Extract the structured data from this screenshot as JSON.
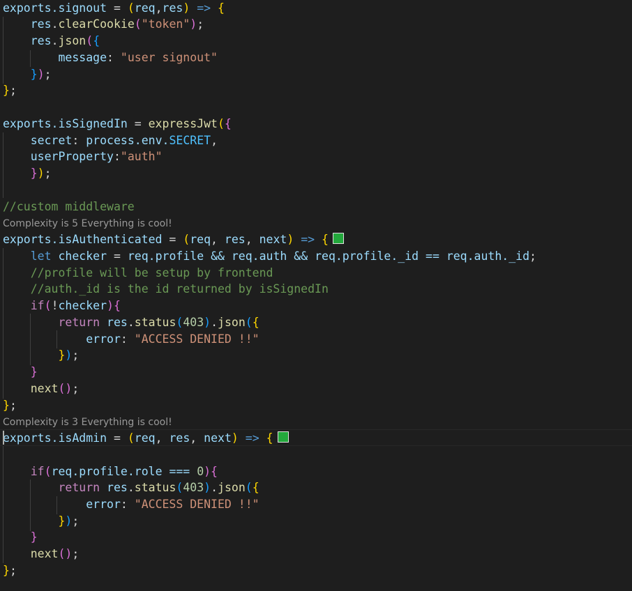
{
  "editor": {
    "code": {
      "signout_export": "exports.signout",
      "clear_cookie": "clearCookie",
      "token_string": "\"token\"",
      "message_key": "message",
      "signout_message": "\"user signout\"",
      "is_signed_in_export": "exports.isSignedIn",
      "express_jwt": "expressJwt",
      "secret_key": "secret",
      "process_env": "process.env.",
      "secret_const": "SECRET",
      "user_property_key": "userProperty",
      "auth_string": "\"auth\"",
      "comment_custom_middleware": "//custom middleware",
      "is_authenticated_export": "exports.isAuthenticated",
      "checker_expr": "req.profile && req.auth && req.profile._id == req.auth._id",
      "comment_profile": "//profile will be setup by frontend",
      "comment_auth_id": "//auth._id is the id returned by isSignedIn",
      "status_code": "403",
      "error_key": "error",
      "access_denied": "\"ACCESS DENIED !!\"",
      "is_admin_export": "exports.isAdmin",
      "role_check": "req.profile.role === ",
      "role_value": "0"
    },
    "codelens": {
      "complexity_authenticated": "Complexity is 5 Everything is cool!",
      "complexity_admin": "Complexity is 3 Everything is cool!"
    },
    "colors": {
      "background": "#1e1e1e",
      "swatch": "#23a83c"
    }
  }
}
